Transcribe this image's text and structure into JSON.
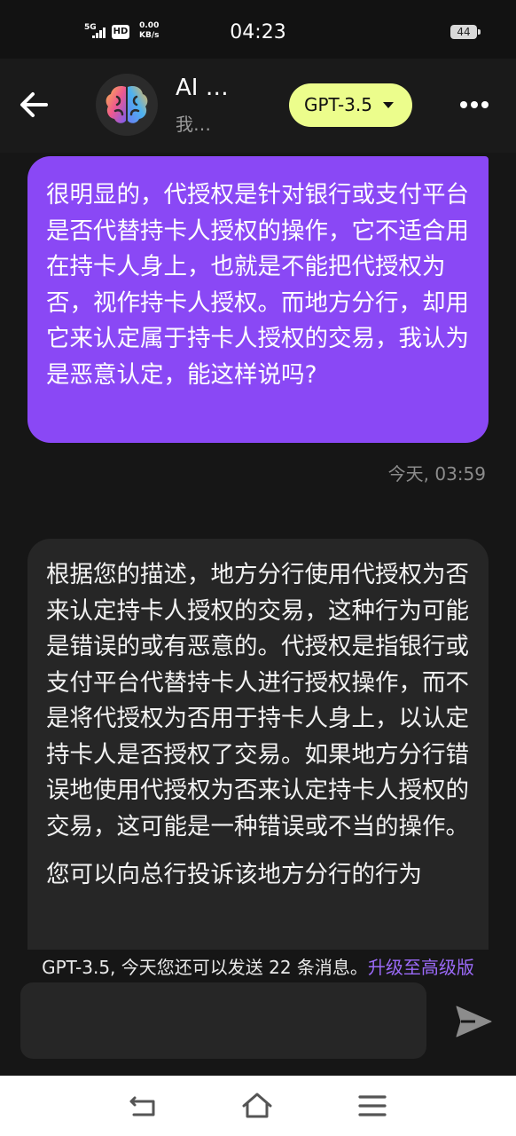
{
  "status_bar": {
    "network": "5G",
    "hd": "HD",
    "speed_value": "0.00",
    "speed_unit": "KB/s",
    "time": "04:23",
    "battery": "44"
  },
  "header": {
    "title": "AI …",
    "subtitle": "我…",
    "model_label": "GPT-3.5"
  },
  "messages": {
    "user": {
      "text": "很明显的，代授权是针对银行或支付平台是否代替持卡人授权的操作，它不适合用在持卡人身上，也就是不能把代授权为否，视作持卡人授权。而地方分行，却用它来认定属于持卡人授权的交易，我认为是恶意认定，能这样说吗?",
      "time": "今天, 03:59"
    },
    "ai": {
      "paragraph1": "根据您的描述，地方分行使用代授权为否来认定持卡人授权的交易，这种行为可能是错误的或有恶意的。代授权是指银行或支付平台代替持卡人进行授权操作，而不是将代授权为否用于持卡人身上，以认定持卡人是否授权了交易。如果地方分行错误地使用代授权为否来认定持卡人授权的交易，这可能是一种错误或不当的操作。",
      "paragraph2": "您可以向总行投诉该地方分行的行为"
    }
  },
  "quota": {
    "text": "GPT-3.5, 今天您还可以发送 22 条消息。",
    "upgrade_link": "升级至高级版"
  },
  "input": {
    "placeholder": "",
    "value": ""
  },
  "icons": {
    "back": "arrow-left-icon",
    "menu": "more-horizontal-icon",
    "send": "send-icon",
    "nav_back": "nav-back-icon",
    "nav_home": "nav-home-icon",
    "nav_recents": "nav-menu-icon"
  },
  "colors": {
    "user_bubble": "#8a48f5",
    "ai_bubble": "#262626",
    "model_button": "#ecfd8c",
    "upgrade_link": "#9b6af8",
    "background": "#161616"
  }
}
